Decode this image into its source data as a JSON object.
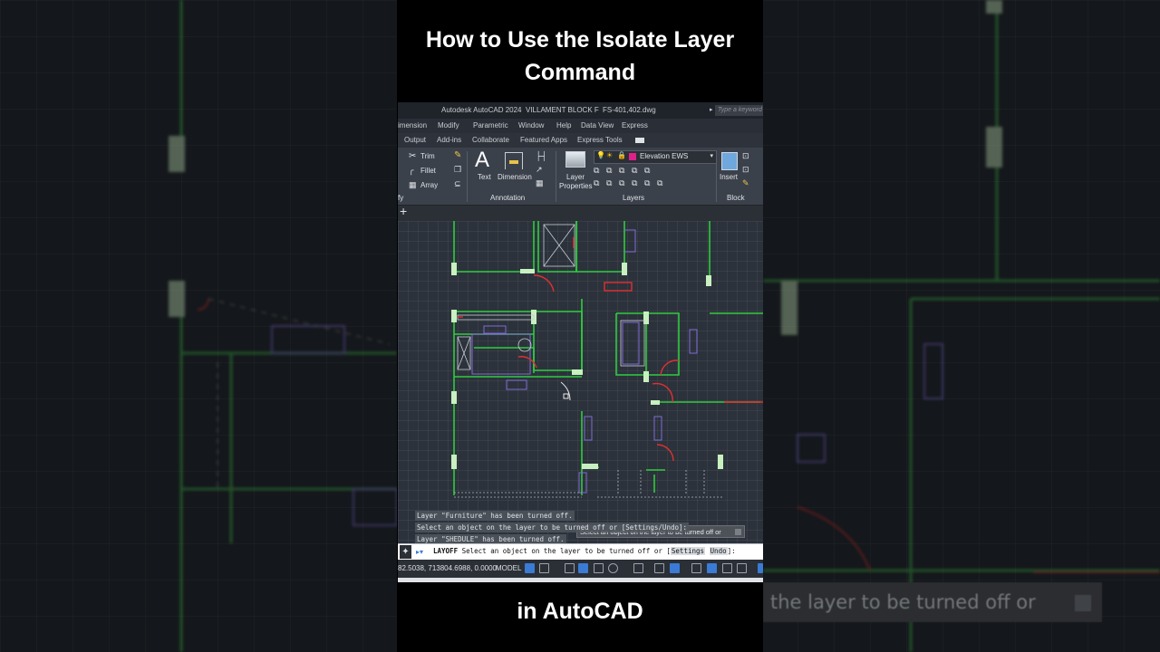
{
  "video": {
    "title": "How to Use the Isolate Layer Command",
    "subtitle": "in AutoCAD"
  },
  "background": {
    "tooltip_text": "the layer to be turned off or"
  },
  "autocad": {
    "app_title": "Autodesk AutoCAD 2024",
    "project": "VILLAMENT BLOCK F",
    "filename": "FS-401,402.dwg",
    "search_placeholder": "Type a keyword",
    "menus": [
      "imension",
      "Modify",
      "Parametric",
      "Window",
      "Help",
      "Data View",
      "Express"
    ],
    "tabs": [
      "Output",
      "Add-ins",
      "Collaborate",
      "Featured Apps",
      "Express Tools"
    ],
    "ribbon": {
      "modify_tools": [
        "Trim",
        "Fillet",
        "Array"
      ],
      "modify_group": "fy",
      "text_label": "Text",
      "dimension_label": "Dimension",
      "annotation_group": "Annotation",
      "layer_properties_label_1": "Layer",
      "layer_properties_label_2": "Properties",
      "current_layer": "Elevation EWS",
      "layer_color": "#e0208a",
      "layers_group": "Layers",
      "insert_label": "Insert",
      "block_group": "Block"
    },
    "canvas_tooltip": "Select an object on the layer to be turned off or",
    "command_history": [
      "Layer \"Furniture\" has been turned off.",
      "Select an object on the layer to be turned off or [Settings/Undo]:",
      "Layer \"SHEDULE\" has been turned off."
    ],
    "command_line": {
      "command": "LAYOFF",
      "prompt": "Select an object on the layer to be turned off or [",
      "option_1": "Settings",
      "option_2": "Undo",
      "end": "]:"
    },
    "status": {
      "coordinates": "82.5038, 713804.6988, 0.0000",
      "mode": "MODEL"
    },
    "colors": {
      "wall": "#2ecc40",
      "furniture": "#7f6bd6",
      "door": "#e03030",
      "accent": "#3a7bd5"
    }
  }
}
